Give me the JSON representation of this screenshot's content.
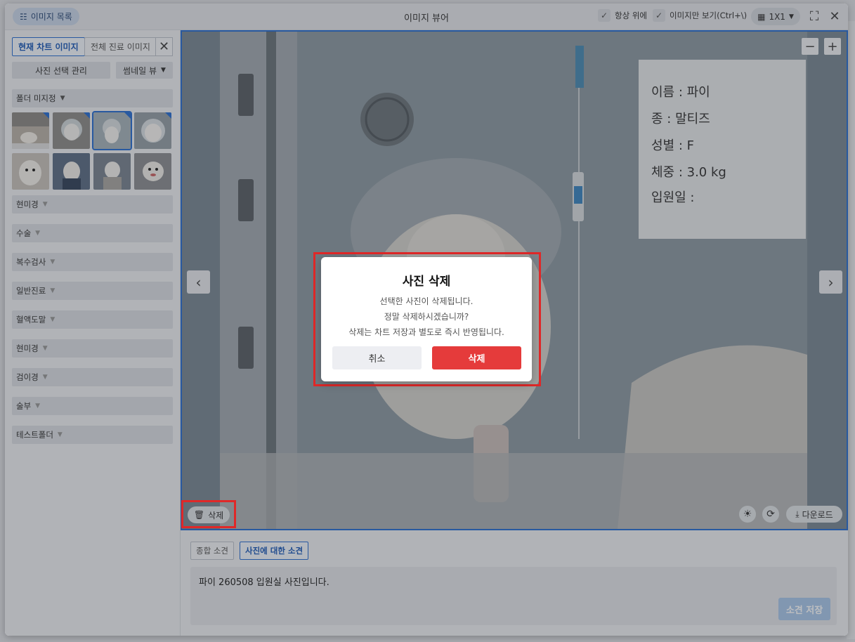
{
  "titlebar": {
    "list_button": "이미지 목록",
    "title": "이미지 뷰어",
    "always_on_top": "항상 위에",
    "image_only": "이미지만 보기(Ctrl+\\)",
    "layout": "1X1"
  },
  "sidebar": {
    "tab_current": "현재 차트 이미지",
    "tab_all": "전체 진료 이미지",
    "select_manage": "사진 선택 관리",
    "thumbnail_view": "썸네일 뷰",
    "folders": [
      "폴더 미지정",
      "현미경",
      "수술",
      "복수검사",
      "일반진료",
      "혈액도말",
      "현미경",
      "검이경",
      "술부",
      "테스트폴더"
    ]
  },
  "viewer": {
    "delete_label": "삭제",
    "download_label": "다운로드",
    "card": [
      "이름 : 파이",
      "종 : 말티즈",
      "성별 : F",
      "체중 : 3.0 kg",
      "입원일 :"
    ]
  },
  "bottom": {
    "tab_summary": "종합 소견",
    "tab_photo": "사진에 대한 소견",
    "memo": "파이 260508 입원실 사진입니다.",
    "save": "소견 저장"
  },
  "modal": {
    "title": "사진 삭제",
    "line1": "선택한 사진이 삭제됩니다.",
    "line2": "정말 삭제하시겠습니까?",
    "line3": "삭제는 차트 저장과 별도로 즉시 반영됩니다.",
    "cancel": "취소",
    "delete": "삭제"
  },
  "colors": {
    "accent": "#2a6fd1",
    "danger": "#e53b3b",
    "highlight": "#e02828"
  }
}
